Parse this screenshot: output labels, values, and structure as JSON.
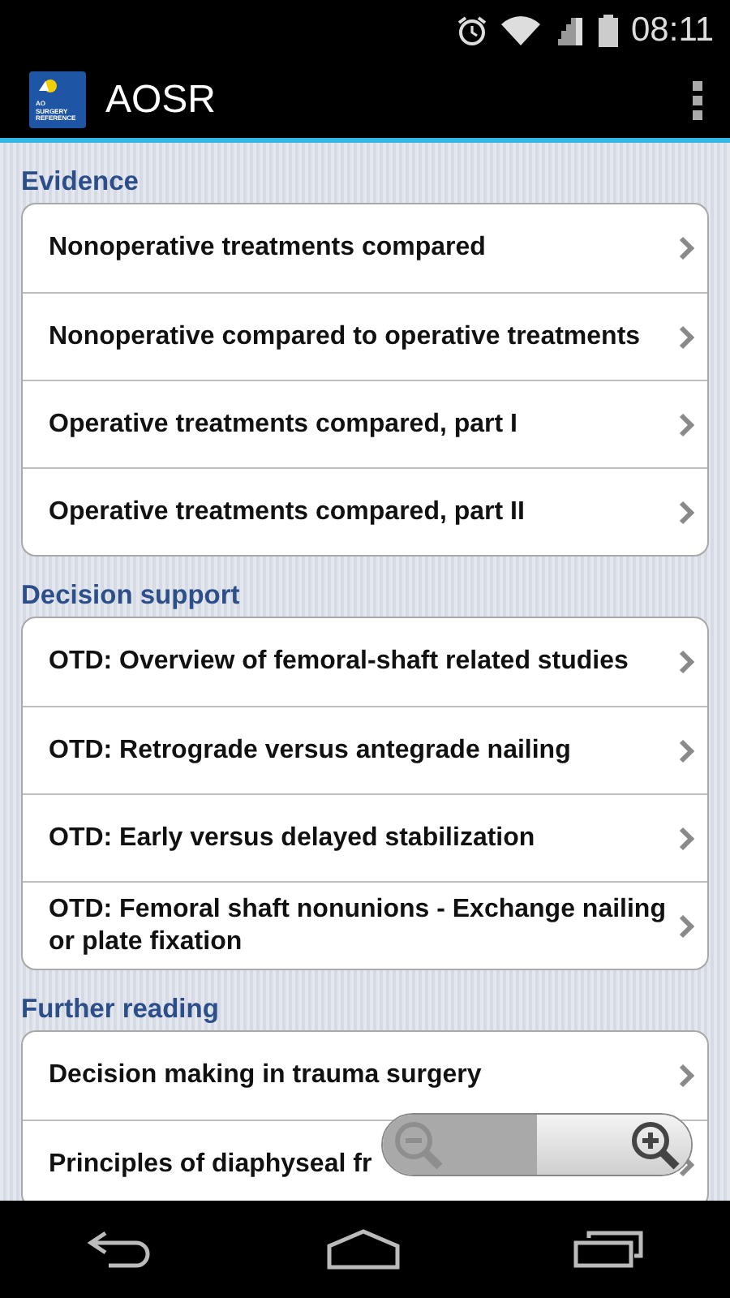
{
  "status_bar": {
    "time": "08:11"
  },
  "app_bar": {
    "logo_lines": [
      "AO",
      "SURGERY",
      "REFERENCE"
    ],
    "title": "AOSR"
  },
  "sections": [
    {
      "title": "Evidence",
      "items": [
        {
          "label": "Nonoperative treatments compared"
        },
        {
          "label": "Nonoperative compared to operative treatments"
        },
        {
          "label": "Operative treatments compared, part I"
        },
        {
          "label": "Operative treatments compared, part II"
        }
      ]
    },
    {
      "title": "Decision support",
      "items": [
        {
          "label": "OTD: Overview of femoral-shaft related studies"
        },
        {
          "label": "OTD: Retrograde versus antegrade nailing"
        },
        {
          "label": "OTD: Early versus delayed stabilization"
        },
        {
          "label": "OTD: Femoral shaft nonunions - Exchange nailing or plate fixation"
        }
      ]
    },
    {
      "title": "Further reading",
      "items": [
        {
          "label": "Decision making in trauma surgery"
        },
        {
          "label": "Principles of diaphyseal fr"
        }
      ]
    }
  ],
  "zoom_controls": {
    "zoom_out_disabled": true,
    "zoom_in_disabled": false
  }
}
